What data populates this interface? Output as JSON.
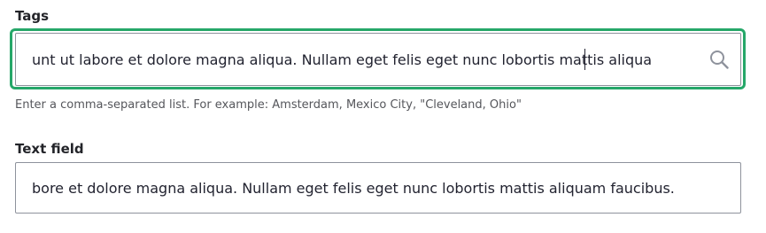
{
  "tags_field": {
    "label": "Tags",
    "value": "incididunt ut labore et dolore magna aliqua. Nullam eget felis eget nunc lobortis mattis aliquam faucibus.",
    "visible_text": "unt ut labore et dolore magna aliqua. Nullam eget felis eget nunc lobortis mattis aliqua",
    "description": "Enter a comma-separated list. For example: Amsterdam, Mexico City, \"Cleveland, Ohio\"",
    "icon": "search-icon",
    "focus_color": "#26a769"
  },
  "text_field": {
    "label": "Text field",
    "visible_text": "bore et dolore magna aliqua. Nullam eget felis eget nunc lobortis mattis aliquam faucibus."
  }
}
